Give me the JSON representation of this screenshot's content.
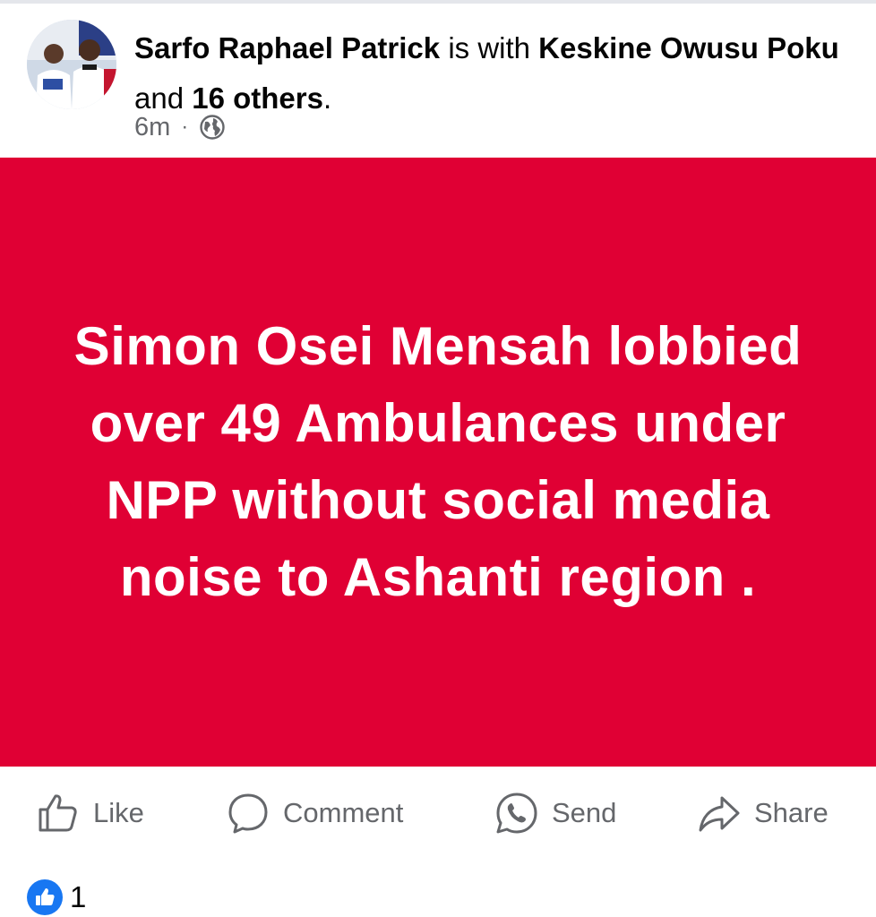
{
  "post": {
    "author": "Sarfo Raphael Patrick",
    "with_text": "is with",
    "tagged_person": "Keskine Owusu Poku",
    "and_text": "and",
    "others": "16 others",
    "period": ".",
    "time": "6m",
    "separator": "·",
    "privacy_icon": "globe-icon",
    "text": "Simon Osei Mensah lobbied over 49 Ambulances under NPP without social media noise to Ashanti region .",
    "background_color": "#e00034"
  },
  "actions": {
    "like": "Like",
    "comment": "Comment",
    "send": "Send",
    "share": "Share"
  },
  "reactions": {
    "icon": "thumbs-up-icon",
    "count": "1"
  },
  "colors": {
    "accent": "#1877f2",
    "secondary_text": "#65676b"
  }
}
